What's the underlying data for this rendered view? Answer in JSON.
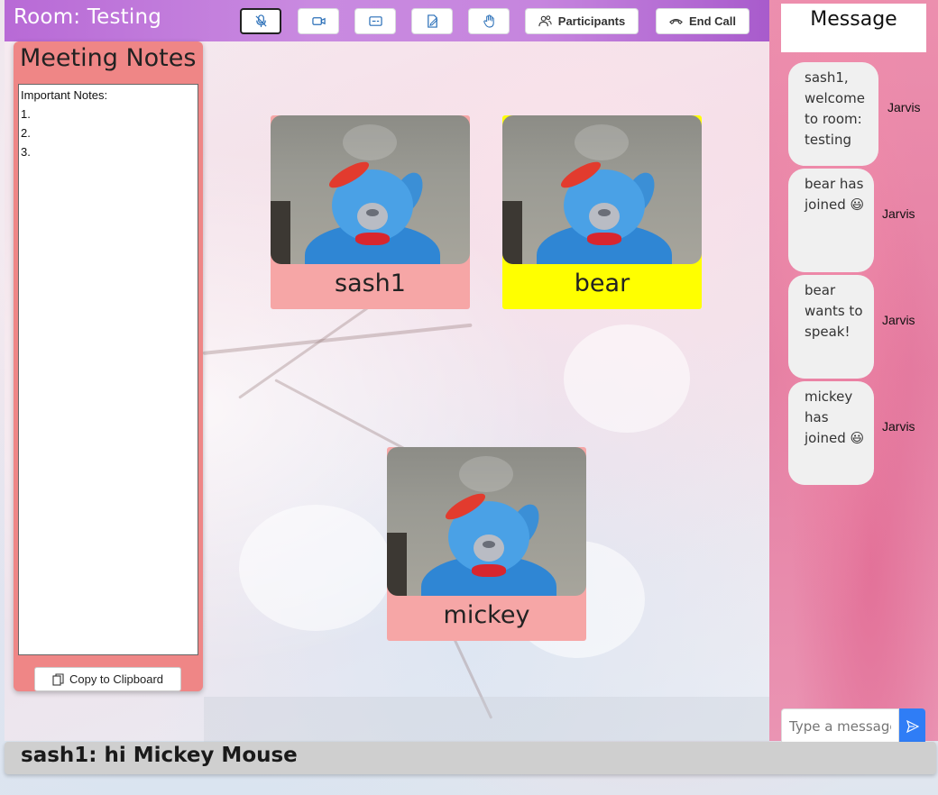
{
  "room": {
    "title": "Room: Testing"
  },
  "toolbar": {
    "buttons": [
      {
        "icon": "microphone-icon"
      },
      {
        "icon": "video-camera-icon"
      },
      {
        "icon": "captions-icon"
      },
      {
        "icon": "notes-icon"
      },
      {
        "icon": "raise-hand-icon"
      }
    ],
    "participants_label": "Participants",
    "end_call_label": "End Call"
  },
  "notes": {
    "title": "Meeting Notes",
    "content": "Important Notes:\n1.\n2.\n3.",
    "copy_label": "Copy to Clipboard"
  },
  "participants": [
    {
      "name": "sash1",
      "speaking": false
    },
    {
      "name": "bear",
      "speaking": true
    },
    {
      "name": "mickey",
      "speaking": false
    }
  ],
  "chat": {
    "header": "Message",
    "messages": [
      {
        "text": "sash1, welcome to room: testing",
        "sender": "Jarvis"
      },
      {
        "text": "bear has joined 😃",
        "sender": "Jarvis"
      },
      {
        "text": "bear wants to speak!",
        "sender": "Jarvis"
      },
      {
        "text": "mickey has joined 😃",
        "sender": "Jarvis"
      }
    ],
    "input_placeholder": "Type a message"
  },
  "caption": {
    "text": "sash1: hi Mickey Mouse"
  },
  "colors": {
    "topbar": "#c17be0",
    "notes_panel": "#ef8686",
    "tile": "#f6a6a6",
    "speaking_tile": "#ffff00",
    "send_button": "#2f7df6"
  }
}
